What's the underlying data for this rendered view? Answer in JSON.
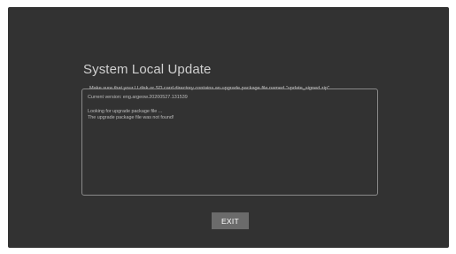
{
  "dialog": {
    "title": "System Local Update",
    "instruction": "Make sure that your U disk or SD card directory contains an upgrade package file named \"update_signed.zip\".",
    "log": {
      "current_version": "Current version: eng.argeow.20200527.131539",
      "looking": "Looking for upgrade package file ...",
      "not_found": "The upgrade package file was not found!"
    },
    "exit_label": "EXIT"
  },
  "colors": {
    "screen_background": "#323232",
    "text": "#c8c8c8",
    "button_background": "#6b6b6b",
    "border": "#8a8a8a"
  }
}
